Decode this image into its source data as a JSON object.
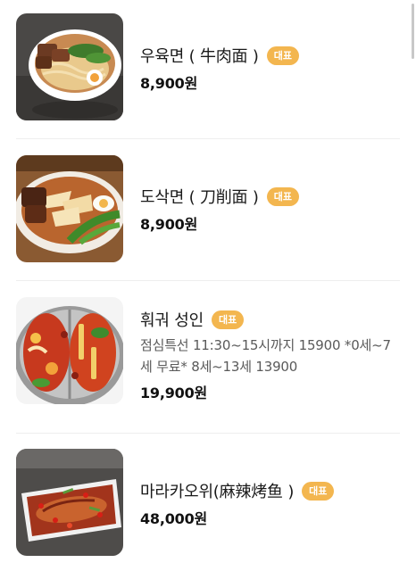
{
  "menu": {
    "items": [
      {
        "name": "우육면 ( 牛肉面 )",
        "badge": "대표",
        "description": "",
        "price": "8,900원",
        "image_icon": "beef-noodle-soup-photo"
      },
      {
        "name": "도삭면 ( 刀削面 )",
        "badge": "대표",
        "description": "",
        "price": "8,900원",
        "image_icon": "knife-cut-noodle-photo"
      },
      {
        "name": "훠궈 성인",
        "badge": "대표",
        "description": "점심특선 11:30~15시까지 15900 *0세~7세 무료* 8세~13세 13900",
        "price": "19,900원",
        "image_icon": "hotpot-photo"
      },
      {
        "name": "마라카오위(麻辣烤鱼 )",
        "badge": "대표",
        "description": "",
        "price": "48,000원",
        "image_icon": "grilled-fish-photo"
      }
    ]
  },
  "colors": {
    "badge": "#f3b64f",
    "price": "#111111",
    "description": "#5a5a5a",
    "divider": "#eeeeee"
  }
}
